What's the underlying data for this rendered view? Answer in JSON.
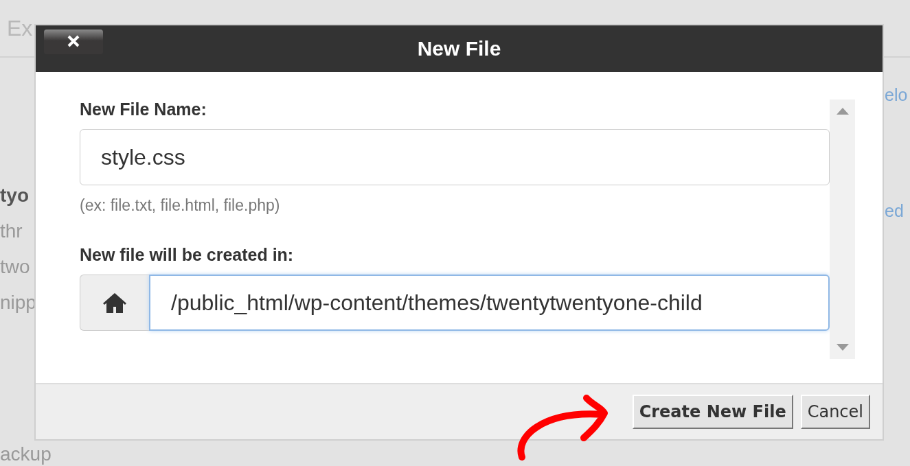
{
  "background": {
    "toolbar_text": "Ex",
    "sidebar_items": [
      {
        "text": "tyo",
        "bold": true
      },
      {
        "text": "thr",
        "bold": false
      },
      {
        "text": "two",
        "bold": false
      },
      {
        "text": "nipp",
        "bold": false
      }
    ],
    "sidebar_footer": "ackup",
    "links": [
      "elo",
      "ed"
    ]
  },
  "dialog": {
    "title": "New File",
    "name_label": "New File Name:",
    "name_value": "style.css",
    "name_hint": "(ex: file.txt, file.html, file.php)",
    "path_label": "New file will be created in:",
    "path_value": "/public_html/wp-content/themes/twentytwentyone-child",
    "buttons": [
      {
        "label": "Create New File",
        "primary": true
      },
      {
        "label": "Cancel",
        "primary": false
      }
    ]
  }
}
